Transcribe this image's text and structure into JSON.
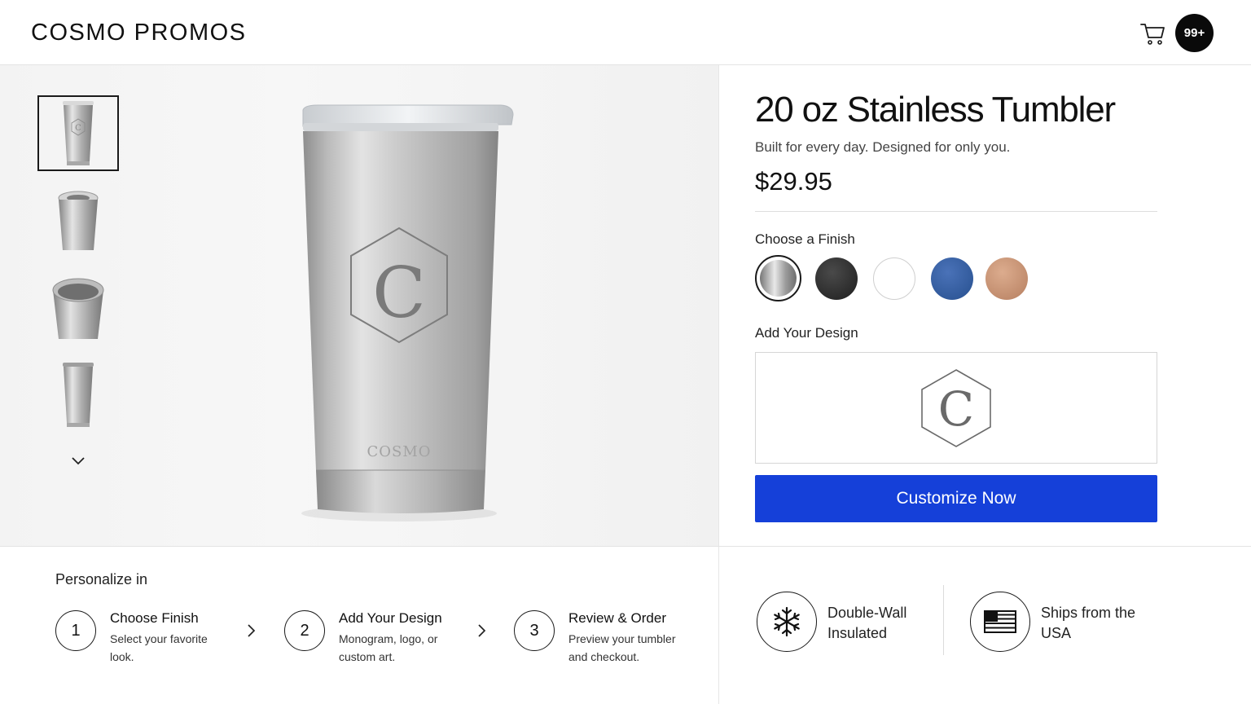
{
  "header": {
    "brand": "COSMO PROMOS",
    "cart_badge": "99+"
  },
  "gallery": {
    "thumbnails": [
      "front-view",
      "angled-lid-view",
      "top-open-view",
      "side-view"
    ],
    "active_thumbnail": 0,
    "engraving_letter": "C",
    "base_text": "COSMO"
  },
  "product": {
    "title": "20 oz Stainless Tumbler",
    "subtitle": "Built for every day. Designed for only you.",
    "price": "$29.95",
    "finish_label": "Choose a Finish",
    "finishes": [
      {
        "name": "stainless",
        "color": "#c9c9c9",
        "selected": true
      },
      {
        "name": "black",
        "color": "#2a2a2a",
        "selected": false
      },
      {
        "name": "white",
        "color": "#ffffff",
        "selected": false
      },
      {
        "name": "navy",
        "color": "#2f5aa0",
        "selected": false
      },
      {
        "name": "copper",
        "color": "#c89070",
        "selected": false
      }
    ],
    "design_label": "Add Your Design",
    "design_preview_letter": "C",
    "cta_label": "Customize Now",
    "accent_color": "#1540d9"
  },
  "steps": {
    "heading": "Personalize in",
    "items": [
      {
        "number": "1",
        "title": "Choose Finish",
        "desc": "Select your favorite look."
      },
      {
        "number": "2",
        "title": "Add Your Design",
        "desc": "Monogram, logo, or custom art."
      },
      {
        "number": "3",
        "title": "Review & Order",
        "desc": "Preview your tumbler and checkout."
      }
    ]
  },
  "features": [
    {
      "icon": "snowflake-icon",
      "label": "Double-Wall Insulated"
    },
    {
      "icon": "us-flag-icon",
      "label": "Ships from the USA"
    }
  ]
}
